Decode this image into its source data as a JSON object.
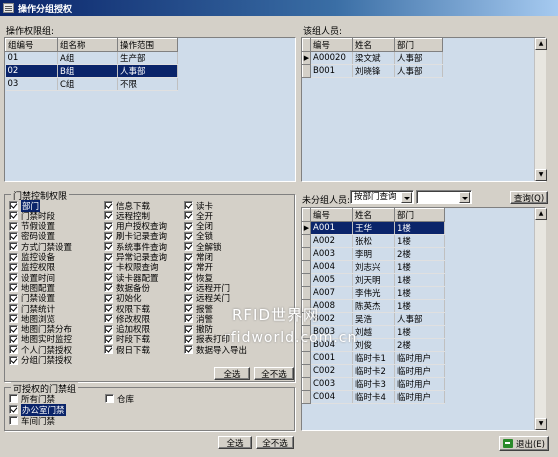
{
  "window": {
    "title": "操作分组授权"
  },
  "group_panel": {
    "label": "操作权限组:",
    "columns": [
      "组编号",
      "组名称",
      "操作范围"
    ],
    "rows": [
      [
        "01",
        "A组",
        "生产部"
      ],
      [
        "02",
        "B组",
        "人事部"
      ],
      [
        "03",
        "C组",
        "不限"
      ]
    ],
    "selected_row": 1
  },
  "members_panel": {
    "label": "该组人员:",
    "columns": [
      "编号",
      "姓名",
      "部门"
    ],
    "rows": [
      [
        "A00020",
        "梁文斌",
        "人事部"
      ],
      [
        "B001",
        "刘晓锋",
        "人事部"
      ]
    ]
  },
  "perm_panel": {
    "label": "门禁控制权限",
    "col1": [
      {
        "label": "部门",
        "checked": true,
        "highlight": true
      },
      {
        "label": "门禁时段",
        "checked": true
      },
      {
        "label": "节假设置",
        "checked": true
      },
      {
        "label": "密码设置",
        "checked": true
      },
      {
        "label": "方式门禁设置",
        "checked": true
      },
      {
        "label": "监控设备",
        "checked": true
      },
      {
        "label": "监控权限",
        "checked": true
      },
      {
        "label": "设置时间",
        "checked": true
      },
      {
        "label": "地图配置",
        "checked": true
      },
      {
        "label": "门禁设置",
        "checked": true
      },
      {
        "label": "门禁统计",
        "checked": true
      },
      {
        "label": "地图浏览",
        "checked": true
      },
      {
        "label": "地图门禁分布",
        "checked": true
      },
      {
        "label": "地图实时监控",
        "checked": true
      },
      {
        "label": "个人门禁授权",
        "checked": true
      },
      {
        "label": "分组门禁授权",
        "checked": true
      }
    ],
    "col2": [
      {
        "label": "信息下载",
        "checked": true
      },
      {
        "label": "远程控制",
        "checked": true
      },
      {
        "label": "用户授权查询",
        "checked": true
      },
      {
        "label": "刷卡记录查询",
        "checked": true
      },
      {
        "label": "系统事件查询",
        "checked": true
      },
      {
        "label": "异常记录查询",
        "checked": true
      },
      {
        "label": "卡权限查询",
        "checked": true
      },
      {
        "label": "读卡器配置",
        "checked": true
      },
      {
        "label": "数据备份",
        "checked": true
      },
      {
        "label": "初始化",
        "checked": true
      },
      {
        "label": "权限下载",
        "checked": true
      },
      {
        "label": "修改权限",
        "checked": true
      },
      {
        "label": "追加权限",
        "checked": true
      },
      {
        "label": "时段下载",
        "checked": true
      },
      {
        "label": "假日下载",
        "checked": true
      }
    ],
    "col3": [
      {
        "label": "读卡",
        "checked": true
      },
      {
        "label": "全开",
        "checked": true
      },
      {
        "label": "全闭",
        "checked": true
      },
      {
        "label": "全锁",
        "checked": true
      },
      {
        "label": "全解锁",
        "checked": true
      },
      {
        "label": "常闭",
        "checked": true
      },
      {
        "label": "常开",
        "checked": true
      },
      {
        "label": "恢复",
        "checked": true
      },
      {
        "label": "远程开门",
        "checked": true
      },
      {
        "label": "远程关门",
        "checked": true
      },
      {
        "label": "报警",
        "checked": true
      },
      {
        "label": "消警",
        "checked": true
      },
      {
        "label": "撤防",
        "checked": true
      },
      {
        "label": "报表打印",
        "checked": true
      },
      {
        "label": "数据导入导出",
        "checked": true
      }
    ],
    "select_all": "全选",
    "select_none": "全不选"
  },
  "door_panel": {
    "label": "可授权的门禁组",
    "items": [
      {
        "label": "所有门禁",
        "checked": false
      },
      {
        "label": "办公室门禁",
        "checked": true,
        "highlight": true
      },
      {
        "label": "车间门禁",
        "checked": false
      }
    ],
    "extra": {
      "label": "仓库",
      "checked": false
    },
    "select_all": "全选",
    "select_none": "全不选"
  },
  "unassigned_panel": {
    "label": "未分组人员:",
    "dept_value": "按部门查询",
    "query_button": "查询(Q)",
    "columns": [
      "编号",
      "姓名",
      "部门"
    ],
    "rows": [
      [
        "A001",
        "王华",
        "1楼"
      ],
      [
        "A002",
        "张松",
        "1楼"
      ],
      [
        "A003",
        "李明",
        "2楼"
      ],
      [
        "A004",
        "刘志兴",
        "1楼"
      ],
      [
        "A005",
        "刘天明",
        "1楼"
      ],
      [
        "A007",
        "李伟光",
        "1楼"
      ],
      [
        "A008",
        "陈英杰",
        "1楼"
      ],
      [
        "B002",
        "吴浩",
        "人事部"
      ],
      [
        "B003",
        "刘越",
        "1楼"
      ],
      [
        "B004",
        "刘俊",
        "2楼"
      ],
      [
        "C001",
        "临时卡1",
        "临时用户"
      ],
      [
        "C002",
        "临时卡2",
        "临时用户"
      ],
      [
        "C003",
        "临时卡3",
        "临时用户"
      ],
      [
        "C004",
        "临时卡4",
        "临时用户"
      ]
    ],
    "selected_row": 0
  },
  "exit_button": "退出(E)",
  "watermark": {
    "line1": "RFID世界网",
    "line2": "rfidworld.com.cn"
  }
}
